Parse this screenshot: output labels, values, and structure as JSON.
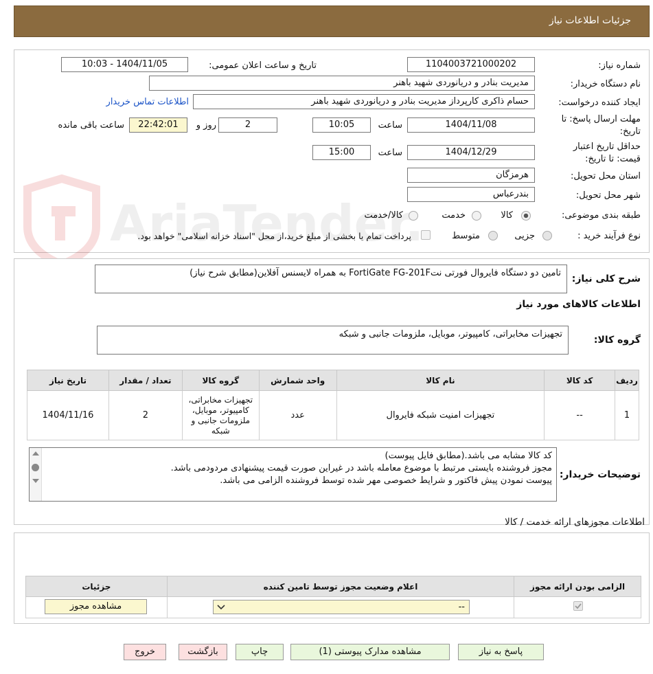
{
  "header": {
    "title": "جزئیات اطلاعات نیاز"
  },
  "watermark": {
    "text": "AriaTender.neT"
  },
  "info": {
    "need_number_label": "شماره نیاز:",
    "need_number": "1104003721000202",
    "announce_label": "تاریخ و ساعت اعلان عمومی:",
    "announce_value": "1404/11/05 - 10:03",
    "buyer_org_label": "نام دستگاه خریدار:",
    "buyer_org": "مدیریت بنادر و دریانوردی شهید باهنر",
    "creator_label": "ایجاد کننده درخواست:",
    "creator": "حسام  ذاکری کارپرداز مدیریت بنادر و دریانوردی شهید باهنر",
    "contact_link": "اطلاعات تماس خریدار",
    "deadline_label_1": "مهلت ارسال پاسخ: تا",
    "deadline_label_2": "تاریخ:",
    "deadline_date": "1404/11/08",
    "time_label": "ساعت",
    "deadline_time": "10:05",
    "days_value": "2",
    "days_label": "روز و",
    "remaining_time": "22:42:01",
    "remaining_label": "ساعت باقی مانده",
    "validity_label_1": "حداقل تاریخ اعتبار",
    "validity_label_2": "قیمت: تا تاریخ:",
    "validity_date": "1404/12/29",
    "validity_time": "15:00",
    "province_label": "استان محل تحویل:",
    "province": "هرمزگان",
    "city_label": "شهر محل تحویل:",
    "city": "بندرعباس",
    "category_label": "طبقه بندی موضوعی:",
    "category_options": [
      "کالا",
      "خدمت",
      "کالا/خدمت"
    ],
    "category_selected": "کالا",
    "process_label": "نوع فرآیند خرید :",
    "process_options": [
      "جزیی",
      "متوسط"
    ],
    "payment_note": "پرداخت تمام یا بخشی از مبلغ خرید،از محل \"اسناد خزانه اسلامی\" خواهد بود."
  },
  "summary": {
    "label": "شرح کلی نیاز:",
    "text": "تامین دو دستگاه فایروال فورتی نتFortiGate FG-201F به همراه لایسنس آفلاین(مطابق شرح نیاز)",
    "goods_title": "اطلاعات کالاهای مورد نیاز",
    "group_label": "گروه کالا:",
    "group_text": "تجهیزات مخابراتی، کامپیوتر، موبایل، ملزومات جانبی و شبکه"
  },
  "goods_table": {
    "headers": [
      "ردیف",
      "کد کالا",
      "نام کالا",
      "واحد شمارش",
      "گروه کالا",
      "تعداد / مقدار",
      "تاریخ نیاز"
    ],
    "rows": [
      {
        "row": "1",
        "code": "--",
        "name": "تجهیزات امنیت شبکه فایروال",
        "unit": "عدد",
        "group": "تجهیزات مخابراتی، کامپیوتر، موبایل، ملزومات جانبی و شبکه",
        "qty": "2",
        "date": "1404/11/16"
      }
    ]
  },
  "buyer_notes": {
    "label": "توضیحات خریدار:",
    "lines": [
      "کد کالا مشابه می باشد.(مطابق فایل پیوست)",
      "مجوز فروشنده بایستی مرتبط با موضوع معامله باشد در غیراین صورت قیمت پیشنهادی مردودمی باشد.",
      "پیوست نمودن پیش فاکتور و شرایط خصوصی مهر شده توسط فروشنده الزامی می باشد."
    ]
  },
  "licenses": {
    "title": "اطلاعات مجوزهای ارائه خدمت / کالا",
    "headers": [
      "الزامی بودن ارائه مجوز",
      "اعلام وضعیت مجوز توسط تامین کننده",
      "جزئیات"
    ],
    "select_value": "--",
    "view_button": "مشاهده مجوز"
  },
  "buttons": {
    "reply": "پاسخ به نیاز",
    "attachments": "مشاهده مدارک پیوستی (1)",
    "print": "چاپ",
    "back": "بازگشت",
    "exit": "خروج"
  },
  "colors": {
    "header_bg": "#8b6b3f",
    "link": "#1a53c7",
    "button_green": "#e9f7dc",
    "button_red": "#fde0e0",
    "field_yellow": "#fbf7cf"
  }
}
